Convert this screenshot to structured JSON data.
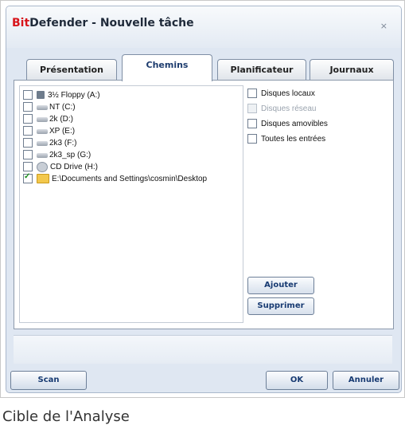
{
  "window": {
    "title_brand": "Bit",
    "title_rest": "Defender - Nouvelle tâche",
    "close": "×"
  },
  "tabs": [
    {
      "label": "Présentation"
    },
    {
      "label": "Chemins"
    },
    {
      "label": "Planificateur"
    },
    {
      "label": "Journaux"
    }
  ],
  "active_tab": "Chemins",
  "drives": [
    {
      "label": "3½ Floppy (A:)",
      "icon": "floppy-icon",
      "checked": false
    },
    {
      "label": "NT (C:)",
      "icon": "hard-drive-icon",
      "checked": false
    },
    {
      "label": "2k (D:)",
      "icon": "hard-drive-icon",
      "checked": false
    },
    {
      "label": "XP (E:)",
      "icon": "hard-drive-icon",
      "checked": false
    },
    {
      "label": "2k3 (F:)",
      "icon": "hard-drive-icon",
      "checked": false
    },
    {
      "label": "2k3_sp (G:)",
      "icon": "hard-drive-icon",
      "checked": false
    },
    {
      "label": "CD Drive (H:)",
      "icon": "cd-drive-icon",
      "checked": false
    },
    {
      "label": "E:\\Documents and Settings\\cosmin\\Desktop",
      "icon": "folder-icon",
      "checked": true
    }
  ],
  "options": [
    {
      "label": "Disques locaux",
      "disabled": false
    },
    {
      "label": "Disques réseau",
      "disabled": true
    },
    {
      "label": "Disques amovibles",
      "disabled": false
    },
    {
      "label": "Toutes les entrées",
      "disabled": false
    }
  ],
  "buttons": {
    "add": "Ajouter",
    "remove": "Supprimer",
    "scan": "Scan",
    "ok": "OK",
    "cancel": "Annuler"
  },
  "caption": "Cible de l'Analyse",
  "colors": {
    "brand_red": "#d8151b",
    "accent_blue": "#173a72"
  }
}
